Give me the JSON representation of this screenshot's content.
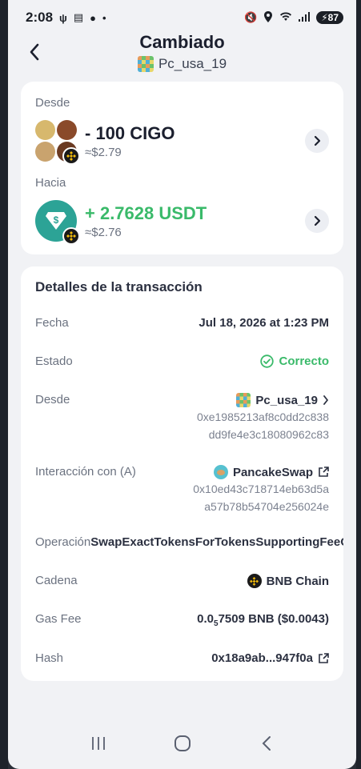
{
  "status_bar": {
    "time": "2:08",
    "battery": "87"
  },
  "header": {
    "title": "Cambiado",
    "wallet_name": "Pc_usa_19"
  },
  "swap": {
    "from_label": "Desde",
    "from_amount": "- 100 CIGO",
    "from_fiat": "≈$2.79",
    "to_label": "Hacia",
    "to_amount": "+ 2.7628 USDT",
    "to_fiat": "≈$2.76"
  },
  "details": {
    "title": "Detalles de la transacción",
    "date_label": "Fecha",
    "date_value": "Jul 18, 2026 at 1:23 PM",
    "status_label": "Estado",
    "status_value": "Correcto",
    "from_label": "Desde",
    "from_wallet": "Pc_usa_19",
    "from_address_line1": "0xe1985213af8c0dd2c838",
    "from_address_line2": "dd9fe4e3c18080962c83",
    "interaction_label": "Interacción con (A)",
    "interaction_name": "PancakeSwap",
    "interaction_address_line1": "0x10ed43c718714eb63d5a",
    "interaction_address_line2": "a57b78b54704e256024e",
    "operation_label": "Operación",
    "operation_value": "SwapExactTokensForTokensSupportingFeeOnTransferTokens",
    "chain_label": "Cadena",
    "chain_value": "BNB Chain",
    "gas_label": "Gas Fee",
    "gas_prefix": "0.0",
    "gas_sub": "5",
    "gas_suffix": "7509 BNB ($0.0043)",
    "hash_label": "Hash",
    "hash_value": "0x18a9ab...947f0a"
  },
  "colors": {
    "positive": "#3aba6a",
    "usdt": "#2ca396",
    "bnb": "#f0b90b"
  }
}
